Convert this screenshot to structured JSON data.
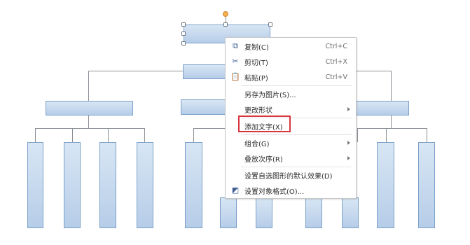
{
  "diagram": {
    "colors": {
      "node_fill_top": "#d8e6f4",
      "node_fill_bottom": "#b6cde8",
      "node_border": "#7ba1c9",
      "connector": "#8a8f96",
      "rotate_handle": "#f4b04f",
      "highlight": "#d9363e"
    }
  },
  "context_menu": {
    "items": [
      {
        "label": "复制(C)",
        "shortcut": "Ctrl+C",
        "icon": "copy-icon",
        "glyph": "⧉"
      },
      {
        "label": "剪切(T)",
        "shortcut": "Ctrl+X",
        "icon": "cut-icon",
        "glyph": "✂"
      },
      {
        "label": "粘贴(P)",
        "shortcut": "Ctrl+V",
        "icon": "paste-icon",
        "glyph": "📋"
      },
      {
        "label": "另存为图片(S)..."
      },
      {
        "label": "更改形状",
        "submenu": true
      },
      {
        "label": "添加文字(X)",
        "highlighted": true
      },
      {
        "label": "组合(G)",
        "submenu": true
      },
      {
        "label": "叠放次序(R)",
        "submenu": true
      },
      {
        "label": "设置自选图形的默认效果(D)"
      },
      {
        "label": "设置对象格式(O)...",
        "icon": "format-object-icon",
        "glyph": "◩"
      }
    ]
  }
}
